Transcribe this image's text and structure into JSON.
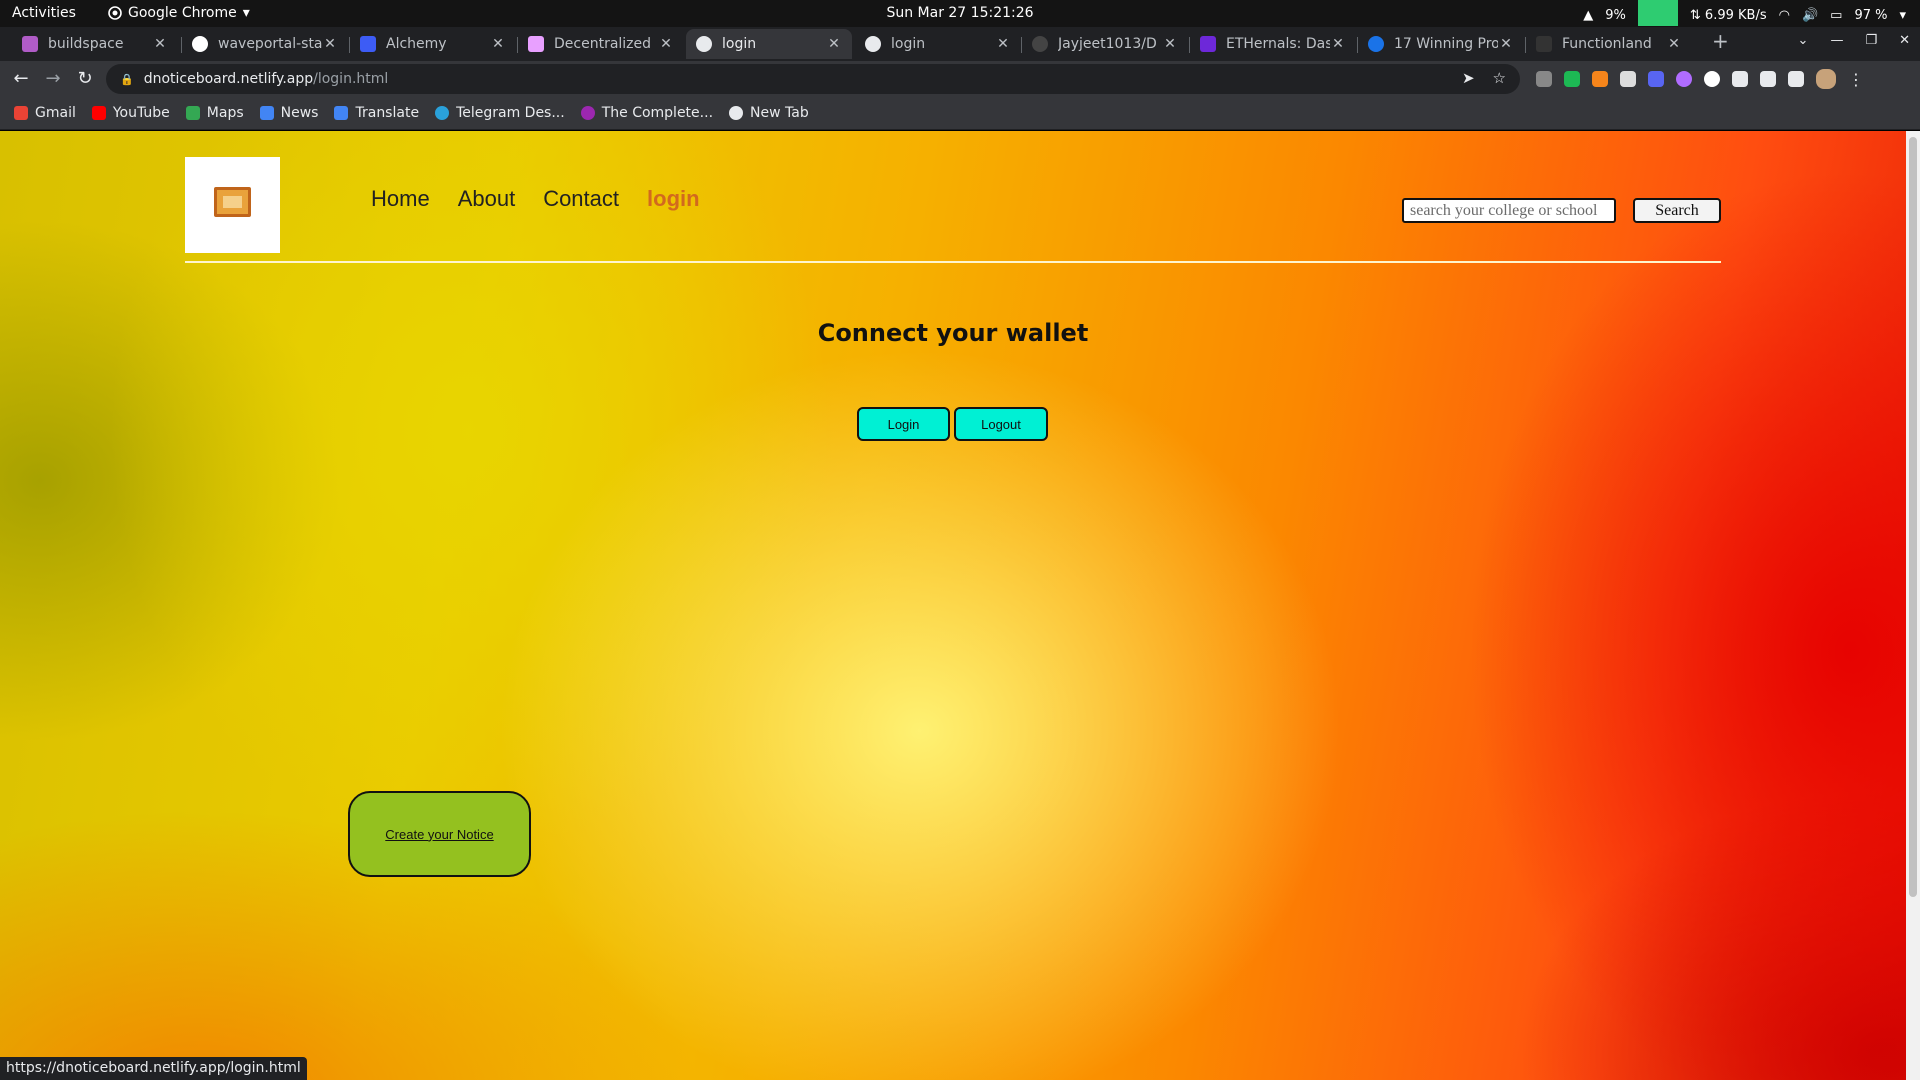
{
  "system_bar": {
    "activities": "Activities",
    "app_name": "Google Chrome",
    "clock": "Sun Mar 27  15:21:26",
    "cpu": "9%",
    "net_speed": "⇅ 6.99 KB/s",
    "battery": "97 %"
  },
  "tabs": [
    {
      "title": "buildspace",
      "color": "#b05cc7"
    },
    {
      "title": "waveportal-sta",
      "color": "#ffffff"
    },
    {
      "title": "Alchemy",
      "color": "#3d5cf5"
    },
    {
      "title": "Decentralized",
      "color": "#e8a0ff"
    },
    {
      "title": "login",
      "color": "#e8eaed"
    },
    {
      "title": "login",
      "color": "#e8eaed"
    },
    {
      "title": "Jayjeet1013/D",
      "color": "#444444"
    },
    {
      "title": "ETHernals: Das",
      "color": "#6d28d9"
    },
    {
      "title": "17 Winning Pro",
      "color": "#1a73e8"
    },
    {
      "title": "Functionland",
      "color": "#333333"
    }
  ],
  "omnibox": {
    "host": "dnoticeboard.netlify.app",
    "path": "/login.html"
  },
  "bookmarks": [
    {
      "label": "Gmail",
      "color": "#ea4335"
    },
    {
      "label": "YouTube",
      "color": "#ff0000"
    },
    {
      "label": "Maps",
      "color": "#34a853"
    },
    {
      "label": "News",
      "color": "#4285f4"
    },
    {
      "label": "Translate",
      "color": "#4285f4"
    },
    {
      "label": "Telegram Des...",
      "color": "#2aa1da"
    },
    {
      "label": "The Complete...",
      "color": "#9c27b0"
    },
    {
      "label": "New Tab",
      "color": "#e8eaed"
    }
  ],
  "page": {
    "nav": {
      "home": "Home",
      "about": "About",
      "contact": "Contact",
      "login": "login"
    },
    "search": {
      "placeholder": "search your college or school",
      "button": "Search"
    },
    "heading": "Connect your wallet",
    "login_button": "Login",
    "logout_button": "Logout",
    "create_notice": "Create your Notice",
    "colors": {
      "accent_nav": "#d2691e",
      "wallet_buttons": "#00f0d4",
      "create_notice": "#94c11f"
    }
  },
  "status_url": "https://dnoticeboard.netlify.app/login.html"
}
